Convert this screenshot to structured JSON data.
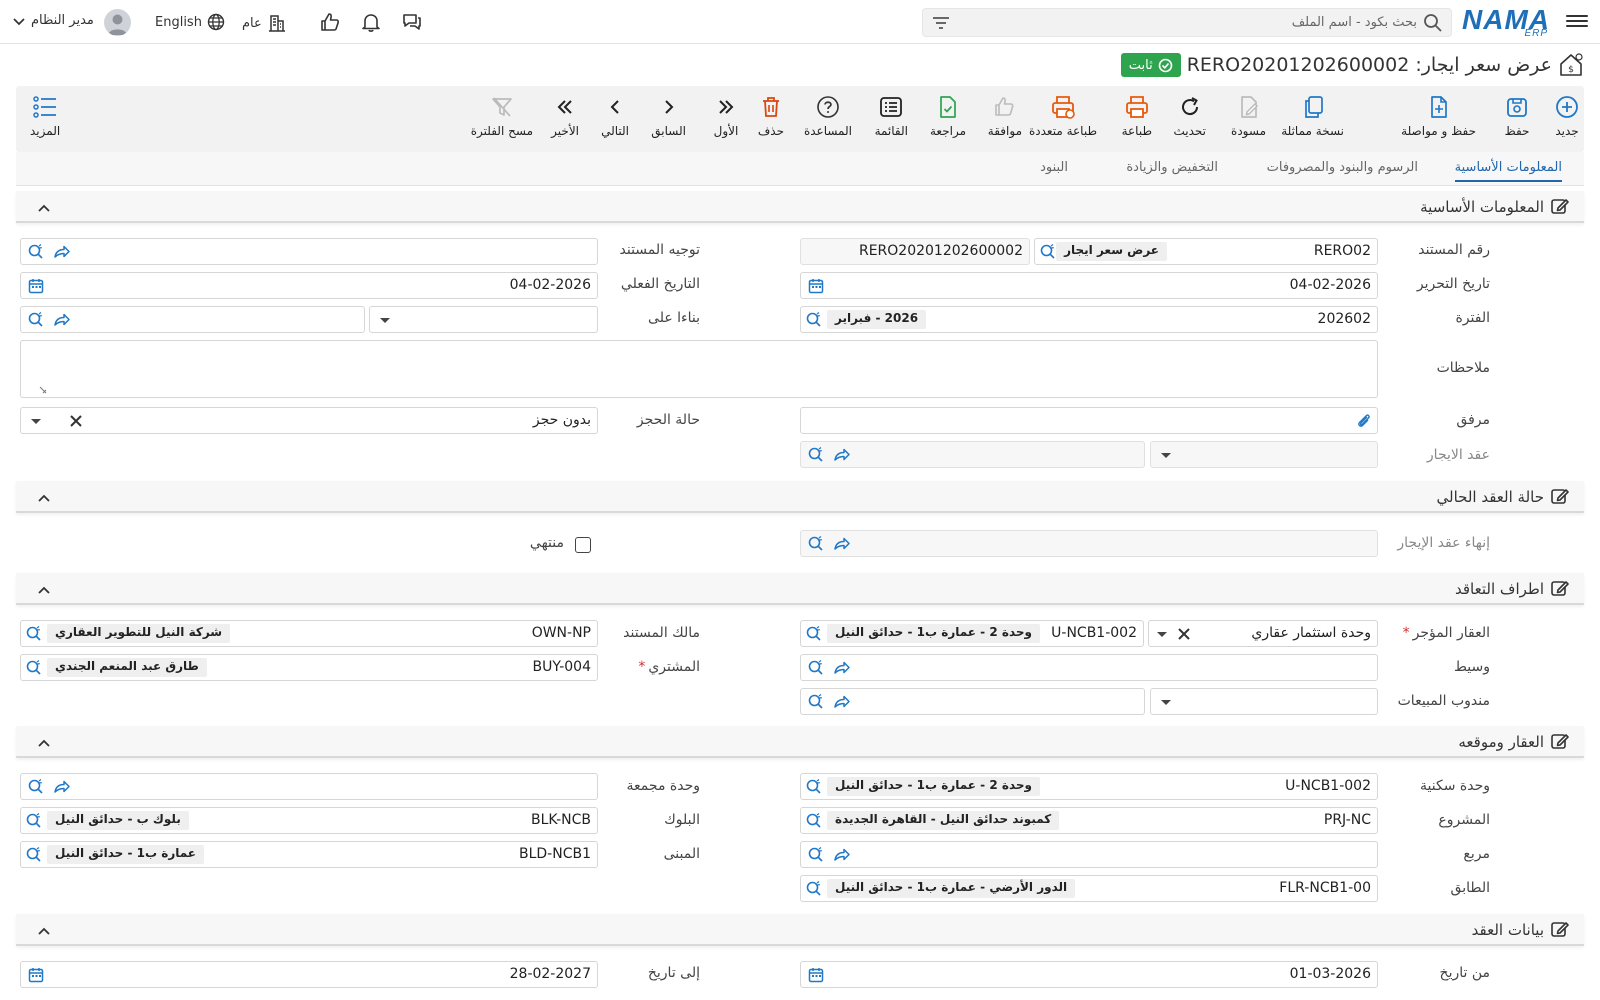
{
  "topbar": {
    "logo": "NAMA",
    "logo_sub": "ERP",
    "search_placeholder": "بحث بكود - اسم الملف",
    "branch": "عام",
    "language": "English",
    "user": "مدير النظام"
  },
  "header": {
    "doc_type": "عرض سعر ايجار:",
    "code": "RERO20201202600002",
    "status": "ثابت"
  },
  "toolbar": {
    "new": "جديد",
    "save": "حفظ",
    "save_continue": "حفظ و مواصلة",
    "duplicate": "نسخة مماثلة",
    "draft": "مسودة",
    "refresh": "تحديث",
    "print": "طباعة",
    "multi_print": "طباعة متعددة",
    "approve": "موافقة",
    "review": "مراجعة",
    "list": "القائمة",
    "help": "المساعدة",
    "delete": "حذف",
    "first": "الأول",
    "previous": "السابق",
    "next": "التالي",
    "last": "الأخير",
    "clear_filter": "مسح الفلترة",
    "more": "المزيد"
  },
  "tabs": [
    "المعلومات الأساسية",
    "الرسوم والبنود والمصروفات",
    "التخفيض والزيادة",
    "البنود"
  ],
  "sections": {
    "basic": "المعلومات الأساسية",
    "current_contract": "حالة العقد الحالي",
    "parties": "اطراف التعاقد",
    "property": "العقار وموقعه",
    "contract_data": "بيانات العقد"
  },
  "fields": {
    "doc_number": {
      "label": "رقم المستند",
      "value": "RERO02",
      "chip": "عرض سعر ايجار",
      "full": "RERO20201202600002"
    },
    "doc_direction": {
      "label": "توجيه المستند"
    },
    "edit_date": {
      "label": "تاريخ التحرير",
      "value": "04-02-2026"
    },
    "actual_date": {
      "label": "التاريخ الفعلي",
      "value": "04-02-2026"
    },
    "period": {
      "label": "الفترة",
      "value": "202602",
      "chip": "2026 - فبراير"
    },
    "based_on": {
      "label": "بناءا على"
    },
    "notes": {
      "label": "ملاحظات"
    },
    "attachment": {
      "label": "مرفق"
    },
    "booking_status": {
      "label": "حالة الحجز",
      "value": "بدون حجز"
    },
    "lease_contract": {
      "label": "عقد الايجار"
    },
    "lease_termination": {
      "label": "إنهاء عقد الإيجار"
    },
    "ended": {
      "label": "منتهي"
    },
    "leased_property": {
      "label": "العقار المؤجر",
      "type": "وحدة استثمار عقاري",
      "value": "U-NCB1-002",
      "chip": "وحدة 2 - عمارة ب1 - حدائق النيل"
    },
    "doc_owner": {
      "label": "مالك المستند",
      "value": "OWN-NP",
      "chip": "شركة النيل للتطوير العقاري"
    },
    "broker": {
      "label": "وسيط"
    },
    "buyer": {
      "label": "المشتري",
      "value": "BUY-004",
      "chip": "طارق عبد المنعم الجندي"
    },
    "sales_rep": {
      "label": "مندوب المبيعات"
    },
    "residential_unit": {
      "label": "وحدة سكنية",
      "value": "U-NCB1-002",
      "chip": "وحدة 2 - عمارة ب1 - حدائق النيل"
    },
    "combined_unit": {
      "label": "وحدة مجمعة"
    },
    "project": {
      "label": "المشروع",
      "value": "PRJ-NC",
      "chip": "كمبوند حدائق النيل - القاهرة الجديدة"
    },
    "block": {
      "label": "البلوك",
      "value": "BLK-NCB",
      "chip": "بلوك ب - حدائق النيل"
    },
    "square": {
      "label": "مربع"
    },
    "building": {
      "label": "المبنى",
      "value": "BLD-NCB1",
      "chip": "عمارة ب1 - حدائق النيل"
    },
    "floor": {
      "label": "الطابق",
      "value": "FLR-NCB1-00",
      "chip": "الدور الأرضي - عمارة ب1 - حدائق النيل"
    },
    "from_date": {
      "label": "من تاريخ",
      "value": "01-03-2026"
    },
    "to_date": {
      "label": "إلى تاريخ",
      "value": "28-02-2027"
    }
  },
  "colors": {
    "accent": "#2267ad",
    "status": "#2ea44f",
    "icon_blue": "#1f78c8",
    "icon_orange": "#e8590c",
    "icon_red": "#d9480f"
  }
}
